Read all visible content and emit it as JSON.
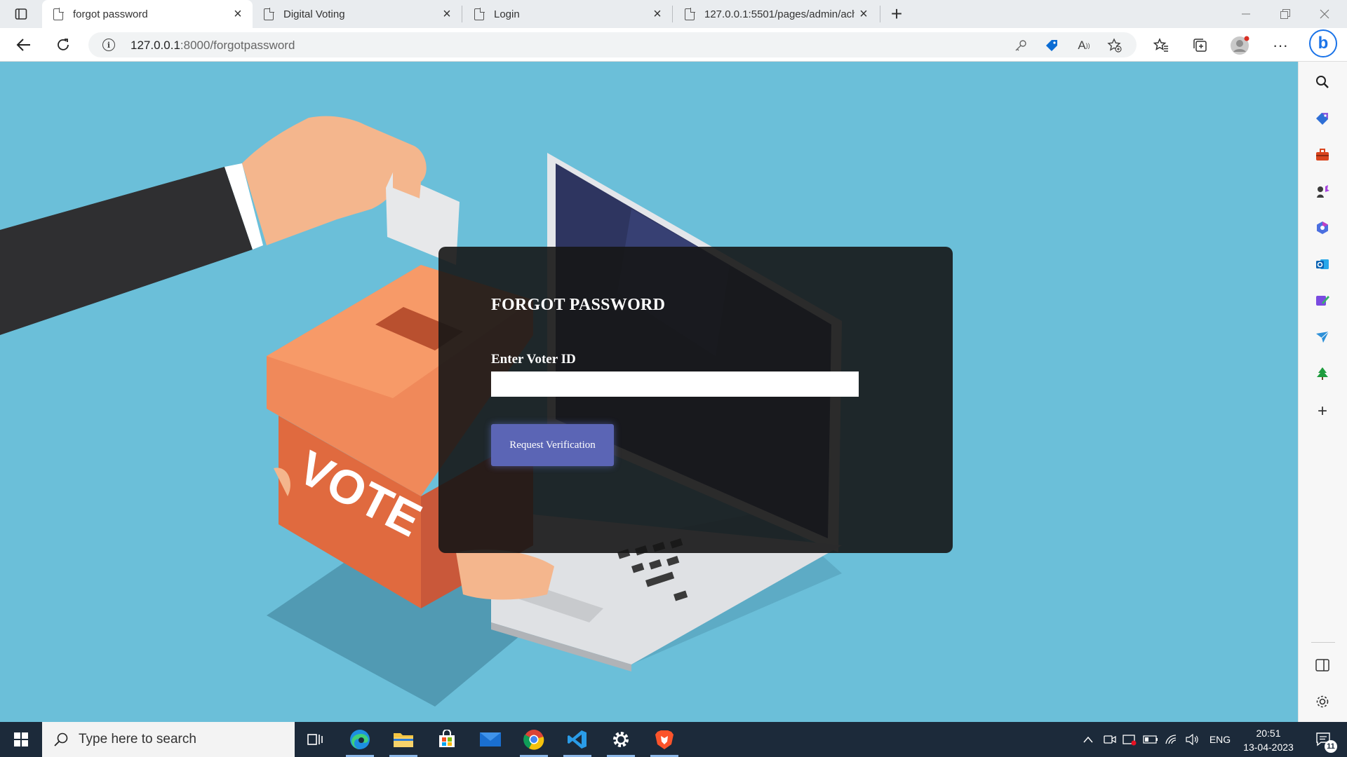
{
  "browser": {
    "tabs": [
      {
        "title": "forgot password",
        "active": true
      },
      {
        "title": "Digital Voting",
        "active": false
      },
      {
        "title": "Login",
        "active": false
      },
      {
        "title": "127.0.0.1:5501/pages/admin/ach",
        "active": false
      }
    ],
    "url_host": "127.0.0.1",
    "url_path": ":8000/forgotpassword"
  },
  "illustration": {
    "ballot_box_text": "VOTE"
  },
  "form": {
    "title": "FORGOT PASSWORD",
    "voter_id_label": "Enter Voter ID",
    "voter_id_value": "",
    "submit_label": "Request Verification"
  },
  "taskbar": {
    "search_placeholder": "Type here to search",
    "language": "ENG",
    "time": "20:51",
    "date": "13-04-2023",
    "notification_count": "11"
  },
  "colors": {
    "page_background": "#6bbfd9",
    "card_background": "#161616",
    "button_background": "#5b65b5",
    "ballot_box": "#e8774f"
  }
}
